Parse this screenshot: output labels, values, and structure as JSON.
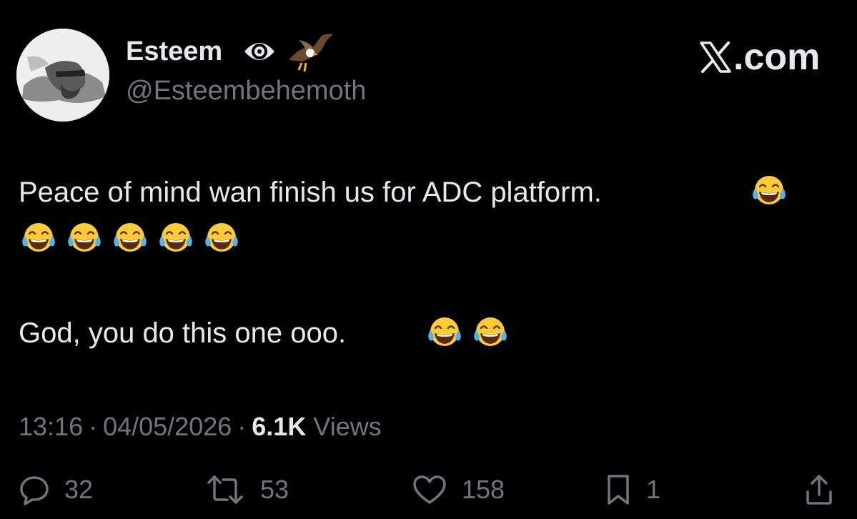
{
  "author": {
    "display_name": "Esteem",
    "handle": "@Esteembehemoth",
    "badge_icon": "eye-badge-icon",
    "extra_icon": "eagle-icon"
  },
  "brand": {
    "label": ".com",
    "icon": "x-logo-icon"
  },
  "tweet": {
    "line1": "Peace of mind wan finish us for ADC platform.",
    "line2": "God, you do this one ooo.",
    "emoji_name": "face-with-tears-of-joy-icon",
    "emoji_counts": [
      1,
      5,
      2
    ]
  },
  "meta": {
    "time": "13:16",
    "date": "04/05/2026",
    "separator": "·",
    "views_count": "6.1K",
    "views_label": "Views"
  },
  "actions": {
    "replies": "32",
    "reposts": "53",
    "likes": "158",
    "bookmarks": "1"
  },
  "colors": {
    "background": "#000000",
    "primary_text": "#e7e9ea",
    "secondary_text": "#71767b"
  }
}
